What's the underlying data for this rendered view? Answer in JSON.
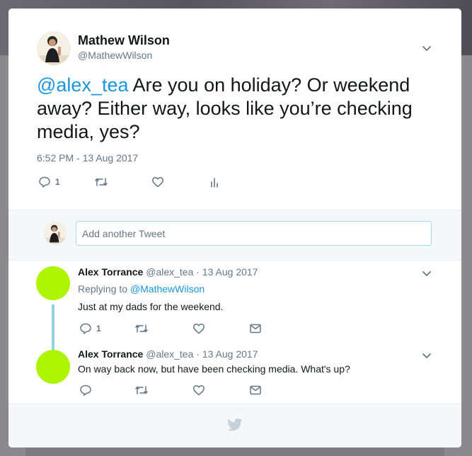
{
  "tweet": {
    "author_name": "Mathew Wilson",
    "author_handle": "@MathewWilson",
    "mention": "@alex_tea",
    "text": " Are you on holiday? Or weekend away? Either way, looks like you’re checking media, yes?",
    "timestamp": "6:52 PM - 13 Aug 2017",
    "reply_count": "1"
  },
  "compose": {
    "placeholder": "Add another Tweet"
  },
  "replies": [
    {
      "author_name": "Alex Torrance",
      "author_handle": "@alex_tea",
      "date": " · 13 Aug 2017",
      "replying_prefix": "Replying to ",
      "replying_to": "@MathewWilson",
      "text": "Just at my dads for the weekend.",
      "reply_count": "1"
    },
    {
      "author_name": "Alex Torrance",
      "author_handle": "@alex_tea",
      "date": " · 13 Aug 2017",
      "text": "On way back now, but have been checking media. What's up?"
    }
  ],
  "colors": {
    "accent": "#1b95e0",
    "avatar_reply": "#aef400",
    "thread_line": "#8fd3e8",
    "icon": "#657786"
  },
  "icons": [
    "chevron-down-icon",
    "reply-icon",
    "retweet-icon",
    "like-icon",
    "analytics-icon",
    "dm-icon",
    "twitter-bird-icon"
  ]
}
